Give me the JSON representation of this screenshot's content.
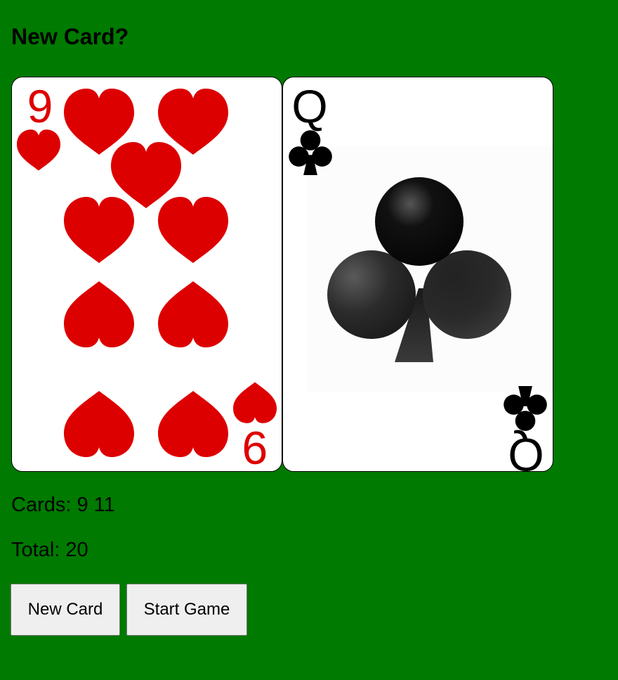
{
  "heading": "New Card?",
  "cards": [
    {
      "rank": "9",
      "suit": "hearts",
      "suit_symbol": "♥",
      "color": "#dd0000"
    },
    {
      "rank": "Q",
      "suit": "clubs",
      "suit_symbol": "♣",
      "color": "#000000"
    }
  ],
  "cards_label": "Cards: 9 11",
  "total_label": "Total: 20",
  "buttons": {
    "new_card": "New Card",
    "start_game": "Start Game"
  },
  "colors": {
    "table": "#007a00",
    "card_face": "#ffffff",
    "hearts": "#dd0000",
    "clubs": "#000000"
  }
}
